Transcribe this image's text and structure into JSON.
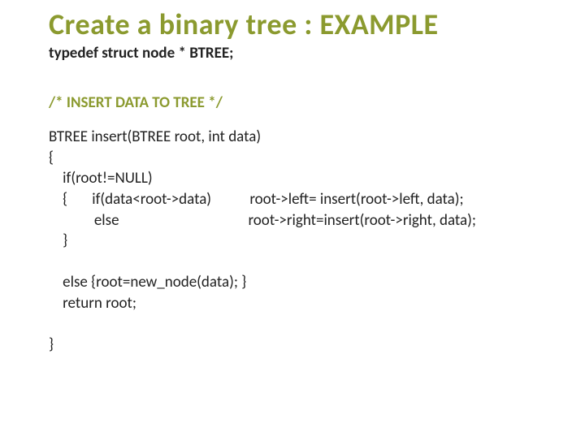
{
  "title": "Create a binary tree : EXAMPLE",
  "typedef": "typedef struct node * BTREE;",
  "comment": "/* INSERT DATA TO  TREE */",
  "code": "BTREE insert(BTREE root, int data)\n{\n    if(root!=NULL)\n    {       if(data<root->data)           root->left= insert(root->left, data);\n             else                                     root->right=insert(root->right, data);\n    }\n\n    else {root=new_node(data); }\n    return root;\n\n}"
}
